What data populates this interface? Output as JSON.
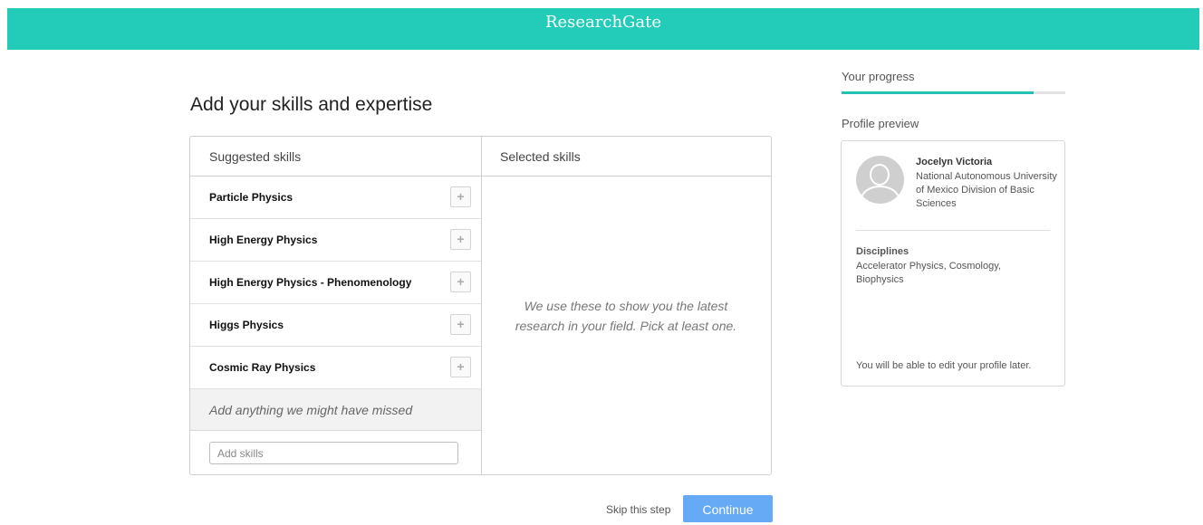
{
  "header": {
    "brand": "ResearchGate"
  },
  "main": {
    "title": "Add your skills and expertise",
    "suggested_header": "Suggested skills",
    "selected_header": "Selected skills",
    "suggested_skills": [
      {
        "label": "Particle Physics",
        "add_glyph": "+"
      },
      {
        "label": "High Energy Physics",
        "add_glyph": "+"
      },
      {
        "label": "High Energy Physics - Phenomenology",
        "add_glyph": "+"
      },
      {
        "label": "Higgs Physics",
        "add_glyph": "+"
      },
      {
        "label": "Cosmic Ray Physics",
        "add_glyph": "+"
      }
    ],
    "missed_prompt": "Add anything we might have missed",
    "add_skills_placeholder": "Add skills",
    "add_skills_value": "",
    "selected_empty_hint": "We use these to show you the latest research in your field. Pick at least one."
  },
  "footer": {
    "skip_label": "Skip this step",
    "continue_label": "Continue"
  },
  "sidebar": {
    "progress_label": "Your progress",
    "progress_fraction": 0.86,
    "preview_label": "Profile preview",
    "profile": {
      "name": "Jocelyn Victoria",
      "affiliation": "National Autonomous University of Mexico Division of Basic Sciences",
      "disciplines_heading": "Disciplines",
      "disciplines": "Accelerator Physics, Cosmology, Biophysics",
      "note": "You will be able to edit your profile later."
    }
  },
  "colors": {
    "brand_teal": "#22ccb8",
    "progress_teal": "#22c1b4",
    "continue_blue": "#66aaf5"
  },
  "icons": {
    "add": "plus-icon",
    "avatar": "default-avatar-icon"
  }
}
